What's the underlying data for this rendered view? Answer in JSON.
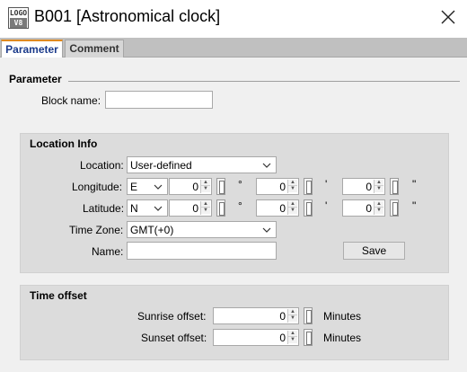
{
  "window": {
    "icon_line1": "LOGO",
    "icon_line2": "V8",
    "title": "B001 [Astronomical clock]"
  },
  "tabs": [
    {
      "label": "Parameter",
      "active": true
    },
    {
      "label": "Comment",
      "active": false
    }
  ],
  "parameter": {
    "section_title": "Parameter",
    "block_name_label": "Block name:",
    "block_name_value": ""
  },
  "location": {
    "title": "Location Info",
    "location_label": "Location:",
    "location_value": "User-defined",
    "longitude_label": "Longitude:",
    "longitude_dir": "E",
    "longitude_deg": "0",
    "longitude_min": "0",
    "longitude_sec": "0",
    "latitude_label": "Latitude:",
    "latitude_dir": "N",
    "latitude_deg": "0",
    "latitude_min": "0",
    "latitude_sec": "0",
    "deg_symbol": "°",
    "min_symbol": "'",
    "sec_symbol": "\"",
    "timezone_label": "Time Zone:",
    "timezone_value": "GMT(+0)",
    "name_label": "Name:",
    "name_value": "",
    "save_label": "Save"
  },
  "time_offset": {
    "title": "Time offset",
    "sunrise_label": "Sunrise offset:",
    "sunrise_value": "0",
    "sunset_label": "Sunset offset:",
    "sunset_value": "0",
    "unit_label": "Minutes"
  },
  "colors": {
    "active_tab_text": "#1a3a8a",
    "active_tab_accent": "#e08a1f",
    "group_bg": "#dcdcdc"
  }
}
